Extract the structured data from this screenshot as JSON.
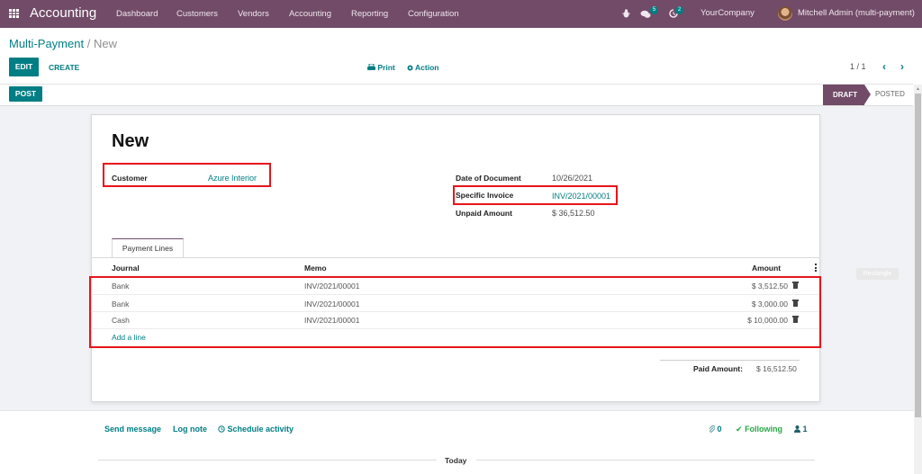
{
  "navbar": {
    "app_name": "Accounting",
    "menu": [
      "Dashboard",
      "Customers",
      "Vendors",
      "Accounting",
      "Reporting",
      "Configuration"
    ],
    "messages_count": "5",
    "activities_count": "2",
    "company": "YourCompany",
    "user": "Mitchell Admin (multi-payment)",
    "colors": {
      "navbar_bg": "#714b67",
      "badge": "#017e84"
    }
  },
  "breadcrumb": {
    "parent": "Multi-Payment",
    "separator": "/",
    "current": "New"
  },
  "control_panel": {
    "edit_label": "EDIT",
    "create_label": "CREATE",
    "print_label": "Print",
    "action_label": "Action",
    "pager": "1 / 1"
  },
  "statusbar": {
    "post_label": "POST",
    "stages": [
      "DRAFT",
      "POSTED"
    ],
    "current_stage": "DRAFT"
  },
  "form": {
    "title": "New",
    "customer_label": "Customer",
    "customer_value": "Azure Interior",
    "date_label": "Date of Document",
    "date_value": "10/26/2021",
    "invoice_label": "Specific Invoice",
    "invoice_value": "INV/2021/00001",
    "unpaid_label": "Unpaid Amount",
    "unpaid_value": "$ 36,512.50"
  },
  "tabs": [
    "Payment Lines"
  ],
  "payment_lines": {
    "columns": [
      "Journal",
      "Memo",
      "Amount"
    ],
    "rows": [
      {
        "journal": "Bank",
        "memo": "INV/2021/00001",
        "amount": "$ 3,512.50"
      },
      {
        "journal": "Bank",
        "memo": "INV/2021/00001",
        "amount": "$ 3,000.00"
      },
      {
        "journal": "Cash",
        "memo": "INV/2021/00001",
        "amount": "$ 10,000.00"
      }
    ],
    "add_line_label": "Add a line"
  },
  "totals": {
    "paid_label": "Paid Amount:",
    "paid_value": "$ 16,512.50"
  },
  "overlay": {
    "rectangle_label": "Rectangle"
  },
  "chatter": {
    "send_message": "Send message",
    "log_note": "Log note",
    "schedule_activity": "Schedule activity",
    "attachments_count": "0",
    "following_label": "Following",
    "followers_count": "1",
    "today_label": "Today"
  }
}
